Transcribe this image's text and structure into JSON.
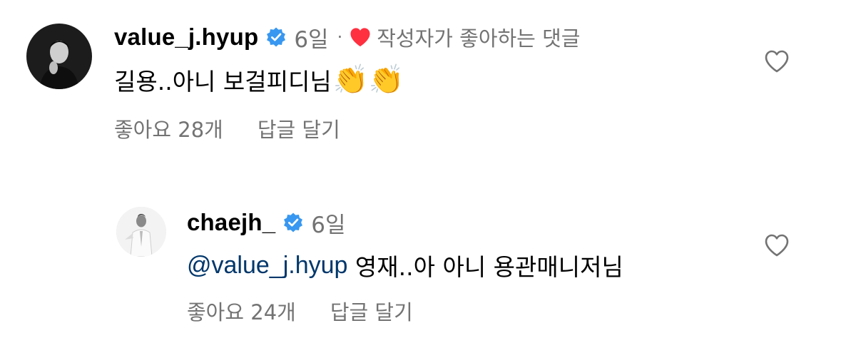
{
  "comments": [
    {
      "username": "value_j.hyup",
      "time": "6일",
      "separator": "·",
      "author_liked": "작성자가 좋아하는 댓글",
      "text": "길용..아니 보걸피디님",
      "emoji": "👏👏",
      "likes": "좋아요 28개",
      "reply": "답글 달기",
      "icons": {
        "verified": "verified-badge-icon",
        "author_heart": "red-heart-icon",
        "like": "heart-outline-icon"
      }
    },
    {
      "username": "chaejh_",
      "time": "6일",
      "mention": "@value_j.hyup",
      "text": " 영재..아 아니 용관매니저님",
      "likes": "좋아요 24개",
      "reply": "답글 달기",
      "icons": {
        "verified": "verified-badge-icon",
        "like": "heart-outline-icon"
      }
    }
  ],
  "colors": {
    "secondary_text": "#737373",
    "mention": "#00376b",
    "verified_blue": "#3897f0",
    "heart_red": "#ff3040"
  }
}
